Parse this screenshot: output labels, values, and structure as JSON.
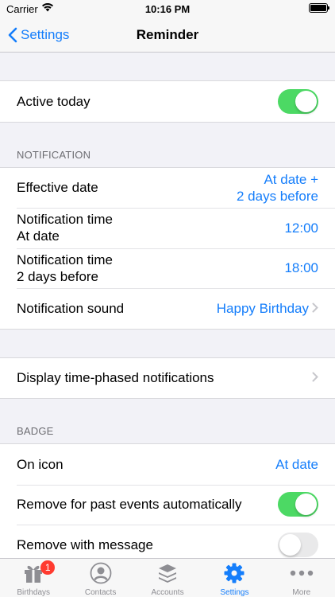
{
  "status": {
    "carrier": "Carrier",
    "time": "10:16 PM"
  },
  "nav": {
    "back_label": "Settings",
    "title": "Reminder"
  },
  "active_today": {
    "label": "Active today",
    "on": true
  },
  "notification": {
    "header": "NOTIFICATION",
    "effective_date": {
      "label": "Effective date",
      "value_line1": "At date +",
      "value_line2": "2 days before"
    },
    "time_at_date": {
      "label_line1": "Notification time",
      "label_line2": "At date",
      "value": "12:00"
    },
    "time_before": {
      "label_line1": "Notification time",
      "label_line2": "2 days before",
      "value": "18:00"
    },
    "sound": {
      "label": "Notification sound",
      "value": "Happy Birthday"
    }
  },
  "phased": {
    "label": "Display time-phased notifications"
  },
  "badge": {
    "header": "BADGE",
    "on_icon": {
      "label": "On icon",
      "value": "At date"
    },
    "remove_past": {
      "label": "Remove for past events automatically",
      "on": true
    },
    "remove_message": {
      "label": "Remove with message",
      "on": false
    }
  },
  "tabs": [
    {
      "label": "Birthdays",
      "icon": "gift-icon",
      "badge": "1"
    },
    {
      "label": "Contacts",
      "icon": "person-icon"
    },
    {
      "label": "Accounts",
      "icon": "stack-icon"
    },
    {
      "label": "Settings",
      "icon": "gear-icon",
      "active": true
    },
    {
      "label": "More",
      "icon": "more-icon"
    }
  ],
  "colors": {
    "accent": "#157efb",
    "toggle_on": "#4cd964",
    "badge": "#ff3b30"
  }
}
